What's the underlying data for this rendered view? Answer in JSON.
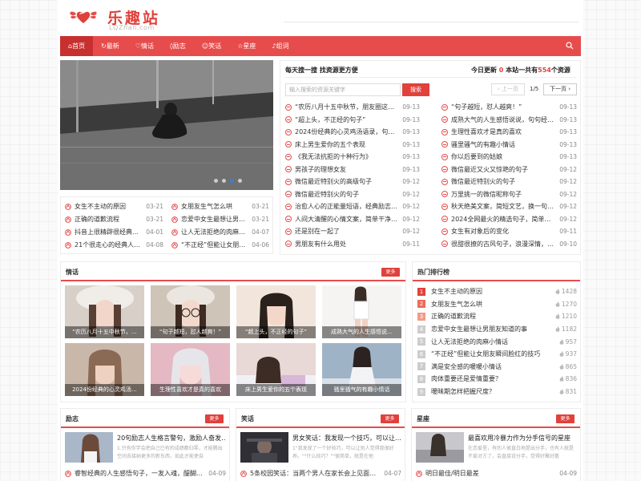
{
  "site": {
    "name": "乐趣站",
    "domain": "LQZhan.com"
  },
  "nav": {
    "items": [
      {
        "label": "首页",
        "icon": "home-icon",
        "active": true
      },
      {
        "label": "最新",
        "icon": "refresh-icon"
      },
      {
        "label": "情话",
        "icon": "heart-icon"
      },
      {
        "label": "励志",
        "icon": "shield-icon"
      },
      {
        "label": "笑话",
        "icon": "smile-icon"
      },
      {
        "label": "星座",
        "icon": "star-icon"
      },
      {
        "label": "组词",
        "icon": "bulb-icon"
      }
    ]
  },
  "search": {
    "title": "每天搜一搜 找资源更方便",
    "stats_prefix": "今日更新",
    "today_count": "0",
    "stats_mid": "本站一共有",
    "total_count": "554",
    "stats_suffix": "个资源",
    "placeholder": "输入搜索的资源关键字",
    "button": "搜索",
    "prev": "上一页",
    "page": "1/5",
    "next": "下一页"
  },
  "slider_list": [
    {
      "title": "女生不主动的原因",
      "date": "03-21"
    },
    {
      "title": "女朋友生气怎么哄",
      "date": "03-21"
    },
    {
      "title": "正确的道歉流程",
      "date": "03-21"
    },
    {
      "title": "恋爱中女生最想让男…",
      "date": "03-21"
    },
    {
      "title": "抖音上很精辟很经典…",
      "date": "04-01"
    },
    {
      "title": "让人无法拒绝的肉麻…",
      "date": "04-07"
    },
    {
      "title": "21个很走心的经典人…",
      "date": "04-08"
    },
    {
      "title": "“不正经”但能让女朋…",
      "date": "04-06"
    }
  ],
  "latest": {
    "left": [
      {
        "title": "“农历八月十五中秋节，朋友圈这样…",
        "date": "09-13"
      },
      {
        "title": "“超上头，不正经的句子”",
        "date": "09-13"
      },
      {
        "title": "2024份经典的心灵鸡汤语录，句句…",
        "date": "09-13"
      },
      {
        "title": "床上男生爱你的五个表现",
        "date": "09-13"
      },
      {
        "title": "《我无法抗拒的十种行为》",
        "date": "09-13"
      },
      {
        "title": "男孩子的理想女友",
        "date": "09-13"
      },
      {
        "title": "微信最近特别火的高级句子",
        "date": "09-12"
      },
      {
        "title": "微信最近特别火的句子",
        "date": "09-12"
      },
      {
        "title": "治愈人心的正能量短语，经典励志…",
        "date": "09-12"
      },
      {
        "title": "人间大清醒的心情文案，简单干净…",
        "date": "09-12"
      },
      {
        "title": "还是别在一起了",
        "date": "09-12"
      },
      {
        "title": "男朋友有什么用处",
        "date": "09-11"
      }
    ],
    "right": [
      {
        "title": "“句子越短，怼人越爽！”",
        "date": "09-13"
      },
      {
        "title": "成熟大气的人生感悟说说，句句经…",
        "date": "09-13"
      },
      {
        "title": "生理性喜欢才是真的喜欢",
        "date": "09-13"
      },
      {
        "title": "骚里骚气的有趣小情话",
        "date": "09-13"
      },
      {
        "title": "你以后要到的姑娘",
        "date": "09-13"
      },
      {
        "title": "微信最近又火又惊艳的句子",
        "date": "09-12"
      },
      {
        "title": "微信最近特别火的句子",
        "date": "09-12"
      },
      {
        "title": "万里挑一的微信昵称句子",
        "date": "09-12"
      },
      {
        "title": "秋天绝美文案，简短文艺，换一句…",
        "date": "09-12"
      },
      {
        "title": "2024全网最火的精选句子，简单干…",
        "date": "09-12"
      },
      {
        "title": "女生有对象后的变化",
        "date": "09-11"
      },
      {
        "title": "很甜很撩的古风句子，浪漫深情，…",
        "date": "09-10"
      }
    ]
  },
  "qinghua": {
    "title": "情话",
    "more": "更多",
    "items": [
      {
        "caption": "“农历八月十五中秋节，…"
      },
      {
        "caption": "“句子越短，怼人越爽！”"
      },
      {
        "caption": "“超上头，不正经的句子”"
      },
      {
        "caption": "成熟大气的人生感悟说…"
      },
      {
        "caption": "2024份经典的心灵鸡汤…"
      },
      {
        "caption": "生理性喜欢才是真的喜欢"
      },
      {
        "caption": "床上男生爱你的五个表现"
      },
      {
        "caption": "骚里骚气的有趣小情话"
      }
    ]
  },
  "ranking": {
    "title": "热门排行榜",
    "items": [
      {
        "rank": "1",
        "title": "女生不主动的原因",
        "views": "1428"
      },
      {
        "rank": "2",
        "title": "女朋友生气怎么哄",
        "views": "1270"
      },
      {
        "rank": "3",
        "title": "正确的道歉流程",
        "views": "1210"
      },
      {
        "rank": "4",
        "title": "恋爱中女生最想让男朋友知道的事",
        "views": "1182"
      },
      {
        "rank": "5",
        "title": "让人无法拒绝的肉麻小情话",
        "views": "957"
      },
      {
        "rank": "6",
        "title": "“不正经”但能让女朋友瞬间脸红的技巧",
        "views": "937"
      },
      {
        "rank": "7",
        "title": "满是安全感的暖暖小情话",
        "views": "865"
      },
      {
        "rank": "8",
        "title": "肉体重要还是爱情重要？",
        "views": "836"
      },
      {
        "rank": "9",
        "title": "暧昧期怎样把握尺度？",
        "views": "831"
      }
    ]
  },
  "lizhi": {
    "title": "励志",
    "more": "更多",
    "feature_title": "20句励志人生格言警句，激励人奋发…",
    "feature_desc": "1.只有你学会把自己已有的成绩都归零，才能腾出空间去接纳更多的新东西，如此才能使自",
    "item_title": "睿智经典的人生感悟句子，一发入魂，醍醐…",
    "item_date": "04-09"
  },
  "xiaohua": {
    "title": "笑话",
    "more": "更多",
    "feature_title": "男女笑话：我发现一个技巧，可以让…",
    "feature_desc": "1\"我发现了一个好技巧，可以让别人觉得我很好养。\"\"什么技巧？\"\"很简单，就是在他",
    "item_title": "5条校园笑话：当两个男人在家长会上见面，…",
    "item_date": "04-07"
  },
  "xingzuo": {
    "title": "星座",
    "more": "更多",
    "feature_title": "最喜欢用冷暴力作为分手信号的星座",
    "feature_desc": "在恋爱里，有的人很直白地提出分手，也有人就是不爱对方了，会直接说分手，觉得好聚好散",
    "item_title": "明日最佳/明日最差",
    "item_date": "04-09"
  },
  "colors": {
    "brand": "#e74c4c",
    "brand_dark": "#c7302f",
    "accent": "#e0413b"
  }
}
